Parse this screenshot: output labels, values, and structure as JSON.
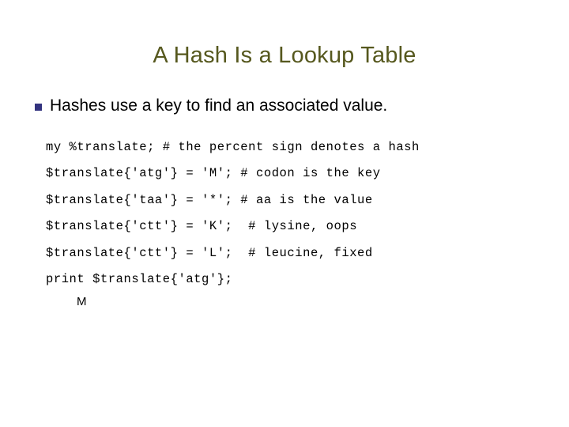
{
  "slide": {
    "title": "A Hash Is a Lookup Table",
    "background_color": "#ffffff",
    "title_color": "#56581e",
    "bullet_color": "#33337f",
    "text_color": "#000000"
  },
  "bullets": [
    {
      "marker": "square-bullet",
      "text": "Hashes use a key to find an associated value."
    }
  ],
  "code": {
    "lines": [
      "my %translate; # the percent sign denotes a hash",
      "$translate{'atg'} = 'M'; # codon is the key",
      "$translate{'taa'} = '*'; # aa is the value",
      "$translate{'ctt'} = 'K';  # lysine, oops",
      "$translate{'ctt'} = 'L';  # leucine, fixed",
      "print $translate{'atg'};"
    ]
  },
  "output": {
    "text": "M"
  }
}
